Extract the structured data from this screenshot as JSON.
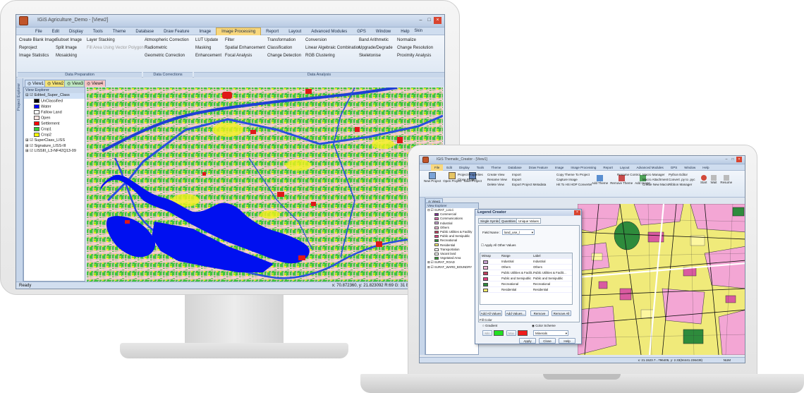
{
  "desktop": {
    "title": "IGiS Agriculture_Demo - [View2]",
    "menu": [
      "File",
      "Edit",
      "Display",
      "Tools",
      "Theme",
      "Database",
      "Draw Feature",
      "Image",
      "Image Processing",
      "Report",
      "Layout",
      "Advanced Modules",
      "GPS",
      "Window",
      "Help"
    ],
    "menu_active": "Image Processing",
    "skin_label": "Skin",
    "ribbon_cols": [
      [
        "Create Blank Image",
        "Reproject",
        "Image Statistics"
      ],
      [
        "Subset Image",
        "Split Image",
        "Mosaicking"
      ],
      [
        "Layer Stacking",
        "Fill Area Using Vector Polygon"
      ],
      [
        "Atmospheric Correction",
        "Radiometric",
        "Geometric Correction"
      ],
      [
        "LUT Update",
        "Masking",
        "Enhancement"
      ],
      [
        "Filter",
        "Spatial Enhancement",
        "Focal Analysis"
      ],
      [
        "Transformation",
        "Classification",
        "Change Detection"
      ],
      [
        "Conversion",
        "Linear Algebraic Combination",
        "RGB Clustering"
      ],
      [
        "Band Arithmetic",
        "Upgrade/Degrade",
        "Skeletonise"
      ],
      [
        "Normalize",
        "Change Resolution",
        "Proximity Analysis"
      ]
    ],
    "ribbon_groups": [
      "Data Preparation",
      "Data Corrections",
      "Data Analysis"
    ],
    "view_tabs": [
      "View1",
      "View2",
      "View3",
      "View4"
    ],
    "side_label": "Project Explorer",
    "explorer_title": "View Explorer",
    "layers": [
      {
        "label": "Edited_Super_Class",
        "color": "#ffffff"
      },
      {
        "label": "UnClassified",
        "color": "#000000"
      },
      {
        "label": "Water",
        "color": "#0000ff"
      },
      {
        "label": "Fallow Land",
        "color": "#ffffff"
      },
      {
        "label": "Open",
        "color": "#ffe4e1"
      },
      {
        "label": "Settlement",
        "color": "#ff0000"
      },
      {
        "label": "Crop1",
        "color": "#33cc33"
      },
      {
        "label": "Crop2",
        "color": "#ffff00"
      },
      {
        "label": "SuperClass_LISS",
        "color": ""
      },
      {
        "label": "Signature_LISS-III",
        "color": ""
      },
      {
        "label": "LISSIII_L3-NF42Q13-09",
        "color": ""
      }
    ],
    "status_left": "Ready",
    "status_coords": "x: 70.872360, y: 21.823092 R:69 G: 31 B: 50"
  },
  "laptop": {
    "title": "IGiS Thematic_Creator - [View1]",
    "menu": [
      "File",
      "Edit",
      "Display",
      "Tools",
      "Theme",
      "Database",
      "Draw Feature",
      "Image",
      "Image Processing",
      "Report",
      "Layout",
      "Advanced Modules",
      "GPS",
      "Window",
      "Help"
    ],
    "ribbon_big": [
      "New Project",
      "Open Project",
      "Save Project"
    ],
    "ribbon_cols": [
      [
        "Project Properties",
        "Close Project"
      ],
      [
        "Create View",
        "Rename View",
        "Delete View"
      ],
      [
        "Import",
        "Export",
        "Export Project Metadata"
      ],
      [
        "Copy Theme To Project",
        "Capture Image",
        "Hit To HS HDP Converter"
      ],
      [
        "Rename Control"
      ],
      [
        "Macro Manager",
        "Macro Attachment",
        "Create New Macro"
      ],
      [
        "Python Editor",
        "Convert .py to .pyc",
        "Ribbon Manager"
      ]
    ],
    "ribbon_big2": [
      "Add Theme",
      "Remove Theme",
      "Add Image"
    ],
    "ribbon_right": [
      "Start",
      "Wait",
      "Resume"
    ],
    "view_tab": "View1",
    "explorer_title": "View Explorer",
    "layers": [
      {
        "label": "SURAT_LULC",
        "color": ""
      },
      {
        "label": "Commercial",
        "color": "#7a2f8e"
      },
      {
        "label": "Communications",
        "color": "#d46ba8"
      },
      {
        "label": "Industrial",
        "color": "#c8a0d0"
      },
      {
        "label": "Others",
        "color": "#f0b8d8"
      },
      {
        "label": "Public Utilities & Facility",
        "color": "#c04060"
      },
      {
        "label": "Public and Semipublic",
        "color": "#e04080"
      },
      {
        "label": "Recreational",
        "color": "#2e8b3c"
      },
      {
        "label": "Residential",
        "color": "#f5e96a"
      },
      {
        "label": "Transportation",
        "color": "#ffffff"
      },
      {
        "label": "Vacant land",
        "color": "#ffffff"
      },
      {
        "label": "Vegetated Area",
        "color": "#3a9c3a"
      },
      {
        "label": "SURAT_ROAD",
        "color": ""
      },
      {
        "label": "SURAT_WARD_BOUNDRY",
        "color": ""
      }
    ],
    "dialog": {
      "title": "Legend Creator",
      "tabs": [
        "Single Symbol",
        "Quantities",
        "Unique Values"
      ],
      "field_label": "Field Name :",
      "field_value": "land_use_l",
      "apply_all": "Apply All Other Values",
      "table_headers": [
        "Mimap",
        "Range",
        "Label"
      ],
      "rows": [
        {
          "range": "Industrial",
          "label": "Industrial",
          "color": "#c8a0d0"
        },
        {
          "range": "Others",
          "label": "Others",
          "color": "#f0b8d8"
        },
        {
          "range": "Public Utilities & Facilit...",
          "label": "Public Utilities & Facilit...",
          "color": "#c04060"
        },
        {
          "range": "Public and Semipublic",
          "label": "Public and Semipublic",
          "color": "#e04080"
        },
        {
          "range": "Recreational",
          "label": "Recreational",
          "color": "#2e8b3c"
        },
        {
          "range": "Residential",
          "label": "Residential",
          "color": "#f5e96a"
        }
      ],
      "buttons_row": [
        "Add All Values",
        "Add Values...",
        "Remove",
        "Remove All"
      ],
      "fill_color": "Fill Color",
      "gradient": "Gradient",
      "color_scheme": "Color Scheme",
      "min_label": "Min",
      "max_label": "Max",
      "scheme_value": "Minerals",
      "footer": [
        "Apply",
        "Close",
        "Help"
      ]
    },
    "status_coords": "x: 21.1523.7...796405, y: 2.33(94441.236439)",
    "status_right": "NUM"
  }
}
